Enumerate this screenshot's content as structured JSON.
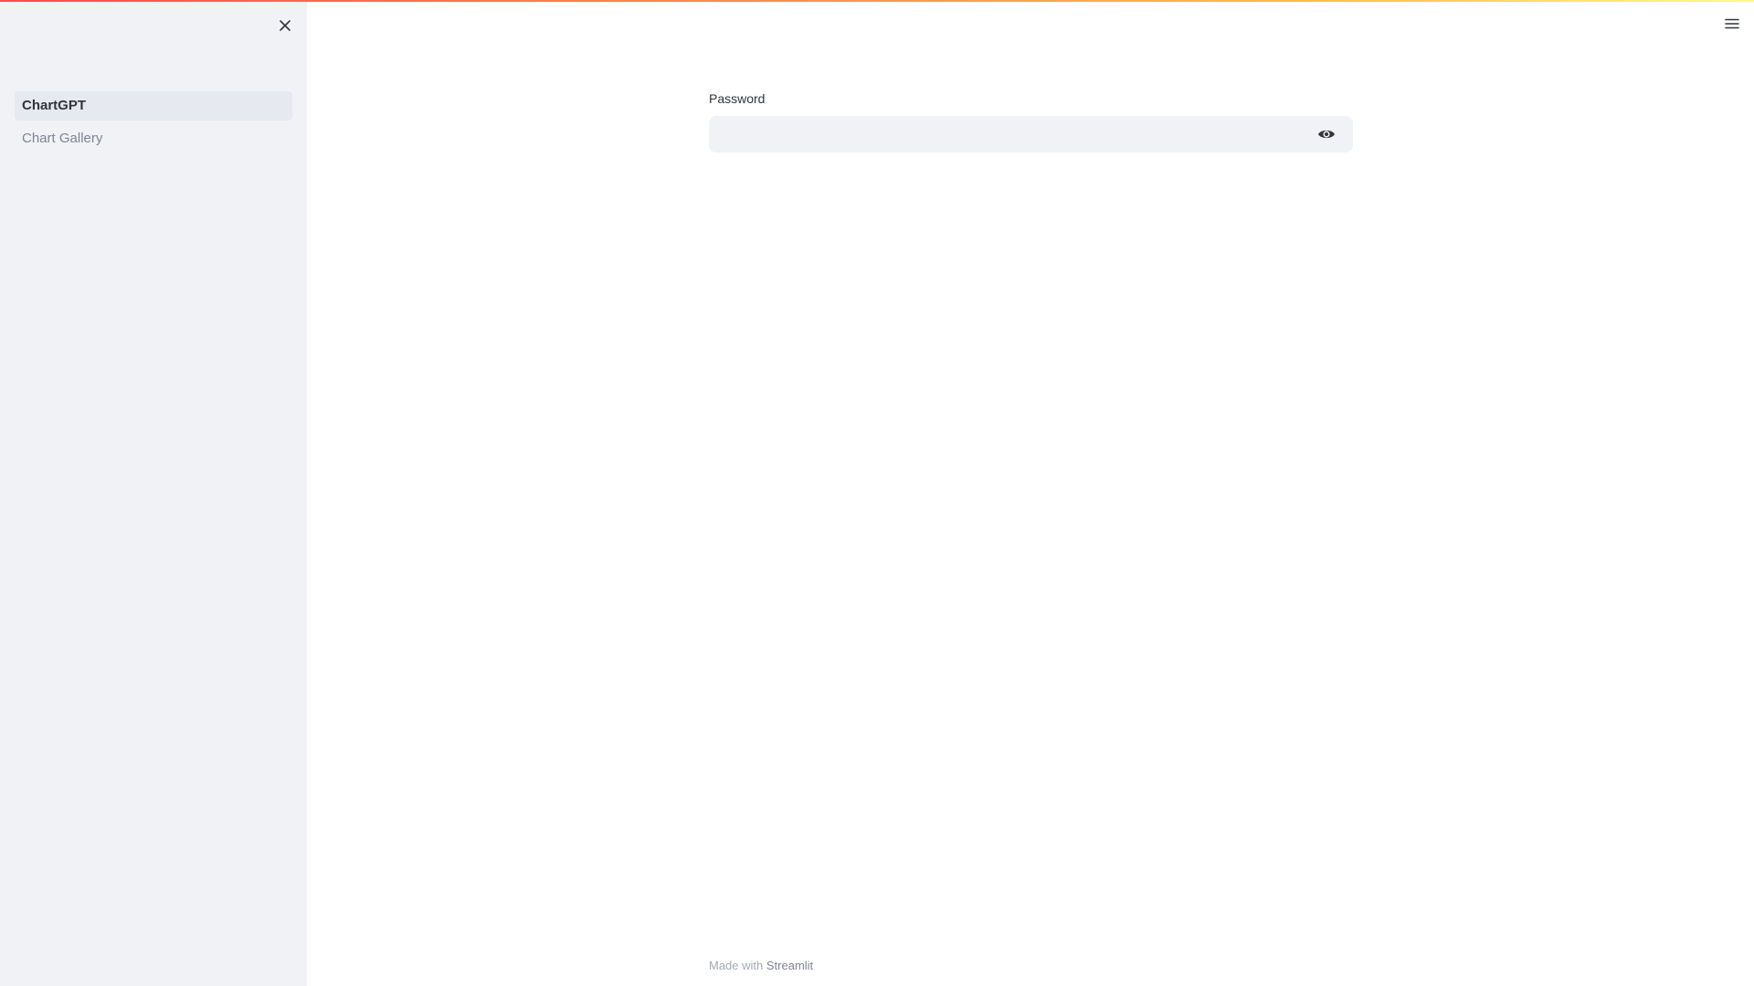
{
  "sidebar": {
    "close_icon": "close-icon",
    "items": [
      {
        "label": "ChartGPT",
        "active": true
      },
      {
        "label": "Chart Gallery",
        "active": false
      }
    ]
  },
  "header": {
    "menu_icon": "hamburger-menu-icon"
  },
  "form": {
    "password_label": "Password",
    "password_value": "",
    "toggle_icon": "eye-icon"
  },
  "footer": {
    "prefix": "Made with",
    "link_label": "Streamlit"
  },
  "colors": {
    "sidebar_bg": "#f0f2f6",
    "input_bg": "#f0f2f6",
    "accent_start": "#ff4b4b",
    "accent_end": "#fffd80"
  }
}
